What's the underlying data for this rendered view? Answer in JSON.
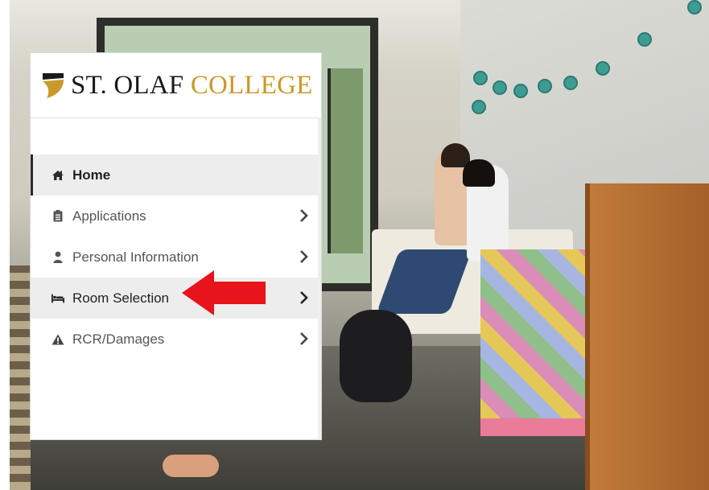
{
  "logo": {
    "name_part1": "ST.",
    "name_part2": "OLAF",
    "name_part3": "COLLEGE",
    "icon": "shield-icon"
  },
  "menu": {
    "items": [
      {
        "label": "Home",
        "icon": "home-icon",
        "state": "active",
        "has_chevron": false
      },
      {
        "label": "Applications",
        "icon": "clipboard-icon",
        "state": "normal",
        "has_chevron": true
      },
      {
        "label": "Personal Information",
        "icon": "user-icon",
        "state": "normal",
        "has_chevron": true
      },
      {
        "label": "Room Selection",
        "icon": "bed-icon",
        "state": "highlighted",
        "has_chevron": true
      },
      {
        "label": "RCR/Damages",
        "icon": "warning-icon",
        "state": "normal",
        "has_chevron": true
      }
    ]
  },
  "annotation": {
    "icon": "red-arrow-icon",
    "color": "#e8141b"
  },
  "colors": {
    "brand_gold": "#c99a2a",
    "brand_black": "#1a1a1a"
  }
}
